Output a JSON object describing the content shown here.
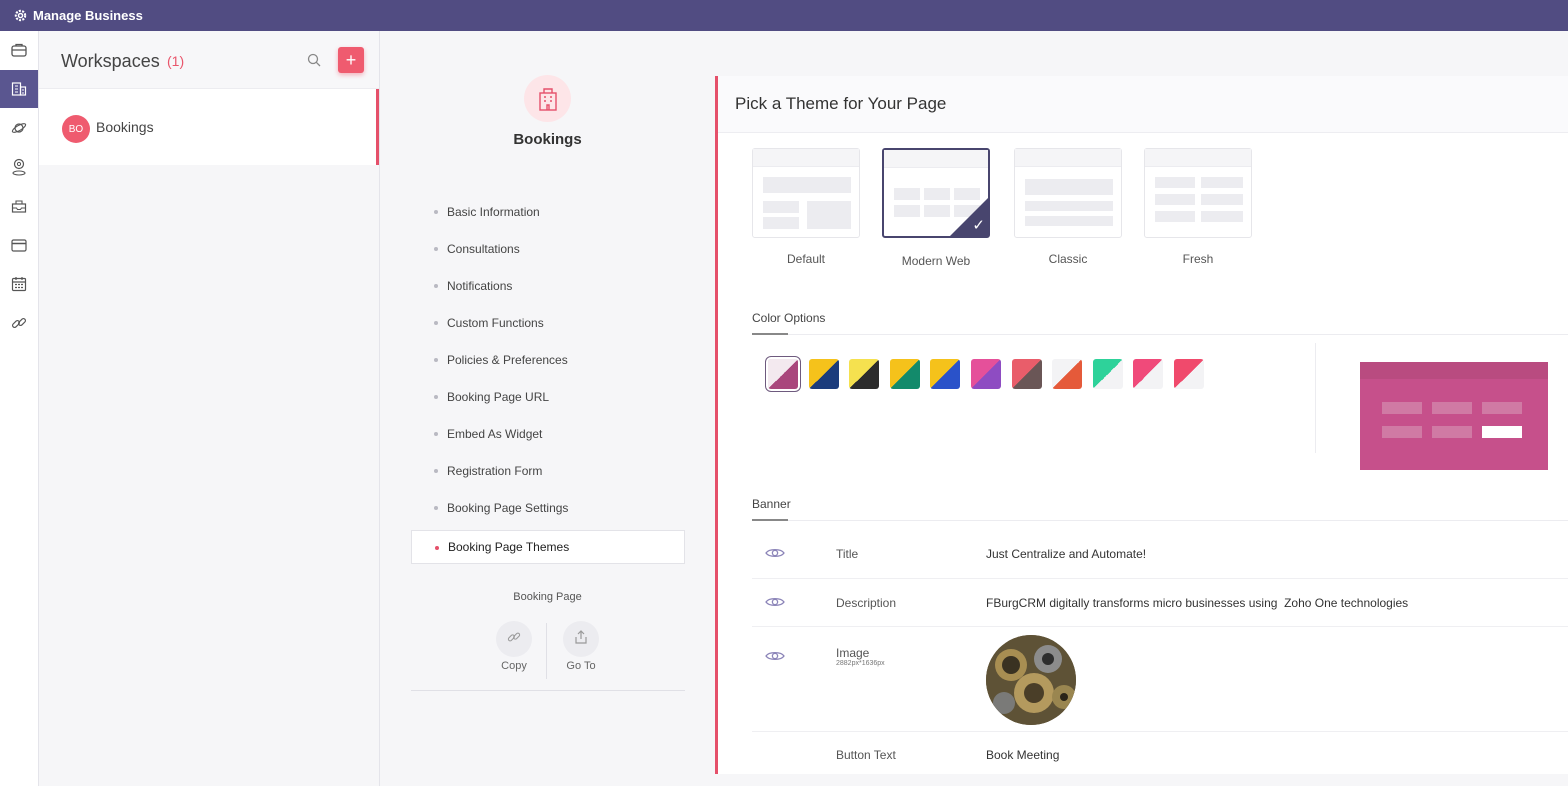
{
  "app": {
    "title": "Manage Business",
    "icon": "gear-icon"
  },
  "rail": {
    "icons": [
      "briefcase-icon",
      "building-icon",
      "planet-icon",
      "location-pin-icon",
      "inbox-icon",
      "card-icon",
      "calendar-icon",
      "link-icon"
    ],
    "active_index": 1,
    "active_color": "#5a5690"
  },
  "workspaces": {
    "title": "Workspaces",
    "count": "(1)",
    "search_icon": "search-icon",
    "add_icon": "plus-icon",
    "items": [
      {
        "initials": "BO",
        "name": "Bookings"
      }
    ]
  },
  "midnav": {
    "icon": "building-icon",
    "title": "Bookings",
    "items": [
      "Basic Information",
      "Consultations",
      "Notifications",
      "Custom Functions",
      "Policies & Preferences",
      "Booking Page URL",
      "Embed As Widget",
      "Registration Form",
      "Booking Page Settings",
      "Booking Page Themes"
    ],
    "active_index": 9,
    "booking_page": {
      "label": "Booking Page",
      "copy_label": "Copy",
      "goto_label": "Go To",
      "copy_icon": "link-icon",
      "goto_icon": "share-icon"
    }
  },
  "main": {
    "title": "Pick a Theme for Your Page",
    "themes": [
      {
        "label": "Default",
        "selected": false
      },
      {
        "label": "Modern Web",
        "selected": true
      },
      {
        "label": "Classic",
        "selected": false
      },
      {
        "label": "Fresh",
        "selected": false
      }
    ],
    "color_options_title": "Color Options",
    "swatches": [
      {
        "c1": "#f3e9ef",
        "c2": "#a9467c",
        "selected": true
      },
      {
        "c1": "#f5c21b",
        "c2": "#1b3c7c",
        "selected": false
      },
      {
        "c1": "#f5e14f",
        "c2": "#2c2c2c",
        "selected": false
      },
      {
        "c1": "#f5c21b",
        "c2": "#138a6b",
        "selected": false
      },
      {
        "c1": "#f5c21b",
        "c2": "#2a52c9",
        "selected": false
      },
      {
        "c1": "#e5509a",
        "c2": "#8e4cc2",
        "selected": false
      },
      {
        "c1": "#e95d6a",
        "c2": "#6a5656",
        "selected": false
      },
      {
        "c1": "#f3f3f5",
        "c2": "#e55a3a",
        "selected": false
      },
      {
        "c1": "#2ed29a",
        "c2": "#f3f3f5",
        "selected": false
      },
      {
        "c1": "#f04a7a",
        "c2": "#f3f3f5",
        "selected": false
      },
      {
        "c1": "#f04a6c",
        "c2": "#f3f3f5",
        "selected": false
      }
    ],
    "preview_color": "#c6508b",
    "banner_title": "Banner",
    "banner_rows": [
      {
        "label": "Title",
        "value": "Just Centralize and Automate!",
        "visible_icon": "eye-icon"
      },
      {
        "label": "Description",
        "value": "FBurgCRM digitally transforms micro businesses using  Zoho One technologies",
        "visible_icon": "eye-icon"
      },
      {
        "label": "Image",
        "sub": "2882px*1636px",
        "value": "",
        "visible_icon": "eye-icon"
      },
      {
        "label": "Button Text",
        "value": "Book Meeting"
      }
    ]
  }
}
